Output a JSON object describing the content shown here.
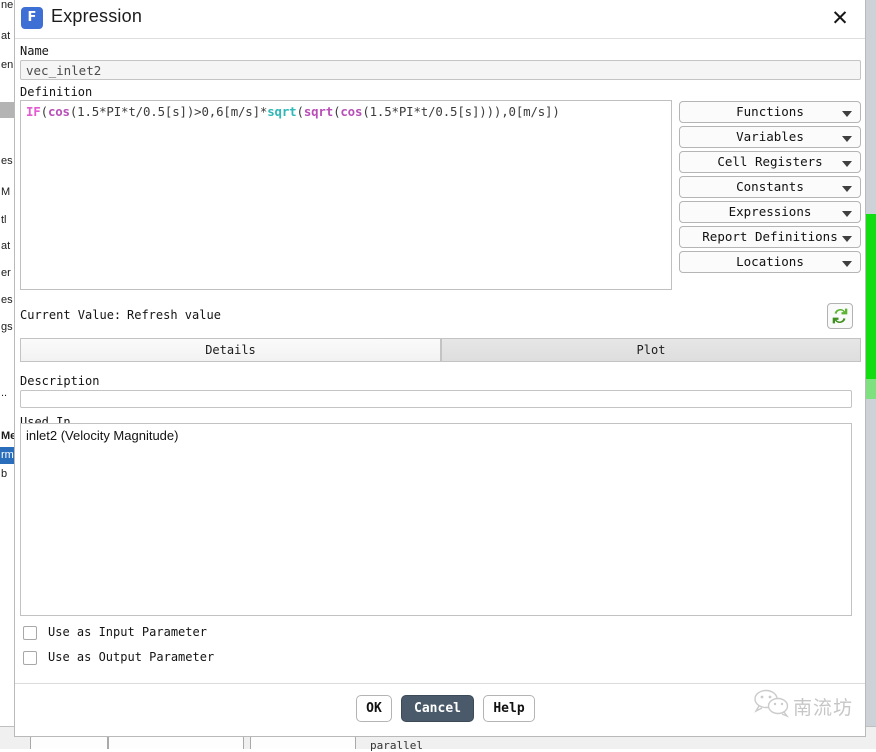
{
  "window": {
    "title": "Expression",
    "icon": "fluent-f-icon",
    "icon_letter": "F",
    "close_icon": "close-icon"
  },
  "form": {
    "name_label": "Name",
    "name_value": "vec_inlet2",
    "definition_label": "Definition",
    "definition_value": "IF(cos(1.5*PI*t/0.5[s])>0,6[m/s]*sqrt(sqrt(cos(1.5*PI*t/0.5[s]))),0[m/s])",
    "definition_tokens": [
      {
        "t": "IF",
        "c": "tok-if"
      },
      {
        "t": "(",
        "c": "tok-plain"
      },
      {
        "t": "cos",
        "c": "tok-fn"
      },
      {
        "t": "(1.5*PI*t/0.5[s])>0,6[m/s]*",
        "c": "tok-plain"
      },
      {
        "t": "sqrt",
        "c": "tok-sqrt"
      },
      {
        "t": "(",
        "c": "tok-plain"
      },
      {
        "t": "sqrt",
        "c": "tok-fn"
      },
      {
        "t": "(",
        "c": "tok-plain"
      },
      {
        "t": "cos",
        "c": "tok-fn"
      },
      {
        "t": "(1.5*PI*t/0.5[s]))),0[m/s])",
        "c": "tok-plain"
      }
    ]
  },
  "insert_menus": [
    {
      "label": "Functions",
      "icon": "chevron-down-icon"
    },
    {
      "label": "Variables",
      "icon": "chevron-down-icon"
    },
    {
      "label": "Cell Registers",
      "icon": "chevron-down-icon"
    },
    {
      "label": "Constants",
      "icon": "chevron-down-icon"
    },
    {
      "label": "Expressions",
      "icon": "chevron-down-icon"
    },
    {
      "label": "Report Definitions",
      "icon": "chevron-down-icon"
    },
    {
      "label": "Locations",
      "icon": "chevron-down-icon"
    }
  ],
  "current_value": {
    "label": "Current Value:",
    "value": "Refresh value",
    "refresh_icon": "refresh-icon",
    "refresh_color": "#3f9c35"
  },
  "tabs": [
    {
      "label": "Details",
      "active": true
    },
    {
      "label": "Plot",
      "active": false
    }
  ],
  "details": {
    "description_label": "Description",
    "description_value": "",
    "used_in_label": "Used In",
    "used_in_items": [
      "inlet2 (Velocity Magnitude)"
    ]
  },
  "parameters": [
    {
      "label": "Use as Input Parameter",
      "checked": false
    },
    {
      "label": "Use as Output Parameter",
      "checked": false
    }
  ],
  "footer_buttons": [
    {
      "label": "OK",
      "primary": false
    },
    {
      "label": "Cancel",
      "primary": true
    },
    {
      "label": "Help",
      "primary": false
    }
  ],
  "watermark": {
    "text": "南流坊",
    "icon": "wechat-logo-icon"
  },
  "background": {
    "left_panel_fragments": [
      "ne",
      "at",
      "en",
      "",
      "",
      "es",
      "M",
      "tl",
      "at",
      "er",
      "es",
      "gs",
      "",
      "..",
      "Me",
      "rm",
      "b"
    ],
    "bottom_label": "parallel"
  }
}
